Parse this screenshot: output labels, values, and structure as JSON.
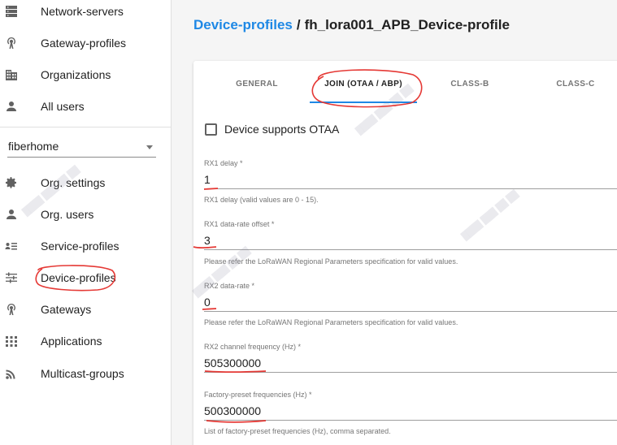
{
  "sidebar": {
    "items_top": [
      {
        "label": "Network-servers",
        "icon": "server-icon"
      },
      {
        "label": "Gateway-profiles",
        "icon": "gateway-profile-icon"
      },
      {
        "label": "Organizations",
        "icon": "domain-icon"
      },
      {
        "label": "All users",
        "icon": "person-icon"
      }
    ],
    "organization_select": {
      "value": "fiberhome"
    },
    "items_org": [
      {
        "label": "Org. settings",
        "icon": "gear-icon"
      },
      {
        "label": "Org. users",
        "icon": "person-icon"
      },
      {
        "label": "Service-profiles",
        "icon": "service-profile-icon"
      },
      {
        "label": "Device-profiles",
        "icon": "tune-icon"
      },
      {
        "label": "Gateways",
        "icon": "gateway-icon"
      },
      {
        "label": "Applications",
        "icon": "apps-grid-icon"
      },
      {
        "label": "Multicast-groups",
        "icon": "rss-feed-icon"
      }
    ]
  },
  "header": {
    "breadcrumb_parent": "Device-profiles",
    "breadcrumb_separator": "/",
    "breadcrumb_current": "fh_lora001_APB_Device-profile"
  },
  "tabs": [
    {
      "label": "GENERAL",
      "active": false
    },
    {
      "label": "JOIN (OTAA / ABP)",
      "active": true
    },
    {
      "label": "CLASS-B",
      "active": false
    },
    {
      "label": "CLASS-C",
      "active": false
    }
  ],
  "form": {
    "supports_otaa": {
      "label": "Device supports OTAA",
      "checked": false
    },
    "rx1_delay": {
      "label": "RX1 delay *",
      "value": "1",
      "help": "RX1 delay (valid values are 0 - 15)."
    },
    "rx1_dr_offset": {
      "label": "RX1 data-rate offset *",
      "value": "3",
      "help": "Please refer the LoRaWAN Regional Parameters specification for valid values."
    },
    "rx2_dr": {
      "label": "RX2 data-rate *",
      "value": "0",
      "help": "Please refer the LoRaWAN Regional Parameters specification for valid values."
    },
    "rx2_freq": {
      "label": "RX2 channel frequency (Hz) *",
      "value": "505300000"
    },
    "factory_freqs": {
      "label": "Factory-preset frequencies (Hz) *",
      "value": "500300000",
      "help": "List of factory-preset frequencies (Hz), comma separated."
    }
  },
  "colors": {
    "accent": "#1e88e5",
    "annotation": "#e53935"
  }
}
